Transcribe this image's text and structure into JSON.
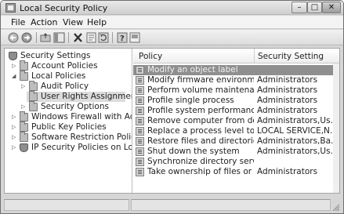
{
  "window": {
    "title": "Local Security Policy",
    "controls": {
      "minimize": "–",
      "maximize": "□",
      "close": "✕"
    }
  },
  "menu": {
    "items": [
      "File",
      "Action",
      "View",
      "Help"
    ]
  },
  "toolbar": {
    "buttons": [
      "back-arrow-icon",
      "forward-arrow-icon",
      "up-folder-icon",
      "show-tree-icon",
      "delete-icon",
      "properties-icon",
      "refresh-icon",
      "help-icon",
      "console-icon"
    ]
  },
  "tree": {
    "items": [
      {
        "label": "Security Settings",
        "expander": "",
        "icon": "shield"
      },
      {
        "label": "Account Policies",
        "expander": "▷",
        "icon": "folder"
      },
      {
        "label": "Local Policies",
        "expander": "◢",
        "icon": "folder"
      },
      {
        "label": "Audit Policy",
        "expander": "▷",
        "icon": "folder"
      },
      {
        "label": "User Rights Assignment",
        "expander": "",
        "icon": "folder",
        "selected": true
      },
      {
        "label": "Security Options",
        "expander": "▷",
        "icon": "folder"
      },
      {
        "label": "Windows Firewall with Advanc",
        "expander": "▷",
        "icon": "folder"
      },
      {
        "label": "Public Key Policies",
        "expander": "▷",
        "icon": "folder"
      },
      {
        "label": "Software Restriction Policies",
        "expander": "▷",
        "icon": "folder"
      },
      {
        "label": "IP Security Policies on Local Co",
        "expander": "▷",
        "icon": "shield"
      }
    ]
  },
  "list": {
    "columns": {
      "policy": "Policy",
      "setting": "Security Setting"
    },
    "rows": [
      {
        "policy": "Modify an object label",
        "setting": "",
        "selected": true
      },
      {
        "policy": "Modify firmware environment ...",
        "setting": "Administrators"
      },
      {
        "policy": "Perform volume maintenance t...",
        "setting": "Administrators"
      },
      {
        "policy": "Profile single process",
        "setting": "Administrators"
      },
      {
        "policy": "Profile system performance",
        "setting": "Administrators"
      },
      {
        "policy": "Remove computer from dockin...",
        "setting": "Administrators,Us..."
      },
      {
        "policy": "Replace a process level token",
        "setting": "LOCAL SERVICE,N..."
      },
      {
        "policy": "Restore files and directories",
        "setting": "Administrators,Ba..."
      },
      {
        "policy": "Shut down the system",
        "setting": "Administrators,Us..."
      },
      {
        "policy": "Synchronize directory service d...",
        "setting": ""
      },
      {
        "policy": "Take ownership of files or other...",
        "setting": "Administrators"
      }
    ]
  }
}
